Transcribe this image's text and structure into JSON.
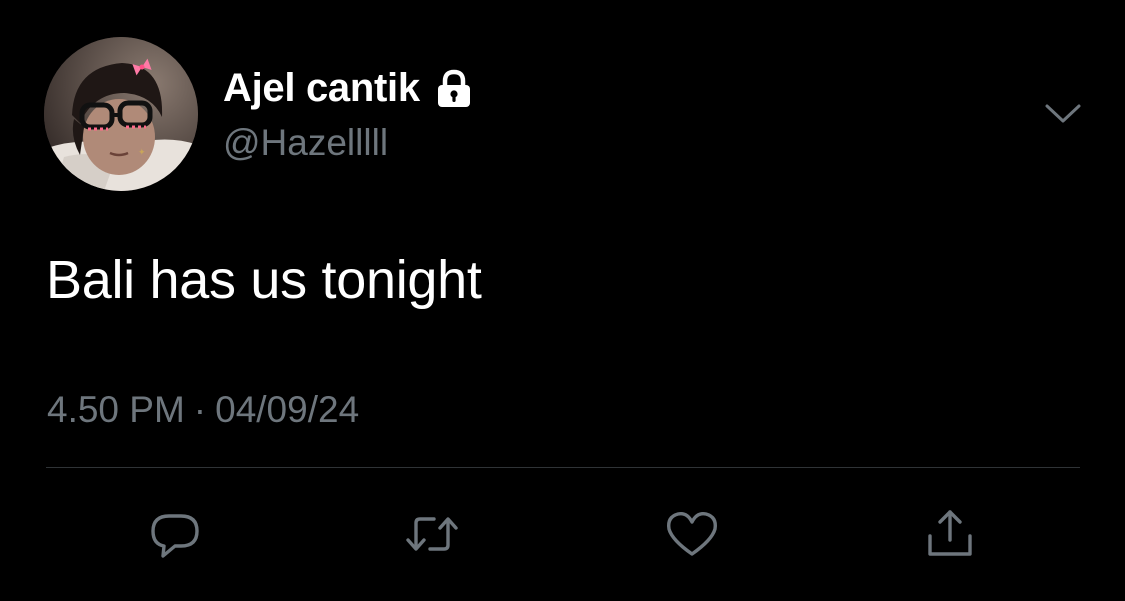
{
  "tweet": {
    "author": {
      "display_name": "Ajel cantik",
      "handle": "@Hazelllll",
      "avatar_icon": "profile-photo",
      "protected_icon": "lock-icon"
    },
    "text": "Bali has us tonight",
    "time": "4.50 PM",
    "separator": "·",
    "date": "04/09/24"
  },
  "actions": [
    {
      "name": "reply",
      "icon": "speech-bubble-icon"
    },
    {
      "name": "retweet",
      "icon": "retweet-arrows-icon"
    },
    {
      "name": "like",
      "icon": "heart-icon"
    },
    {
      "name": "share",
      "icon": "share-upload-icon"
    }
  ],
  "menu": {
    "icon": "chevron-down-icon"
  },
  "colors": {
    "background": "#000000",
    "primary_text": "#ffffff",
    "secondary_text": "#6e767d",
    "divider": "#2f3336",
    "icon": "#6e767d"
  }
}
